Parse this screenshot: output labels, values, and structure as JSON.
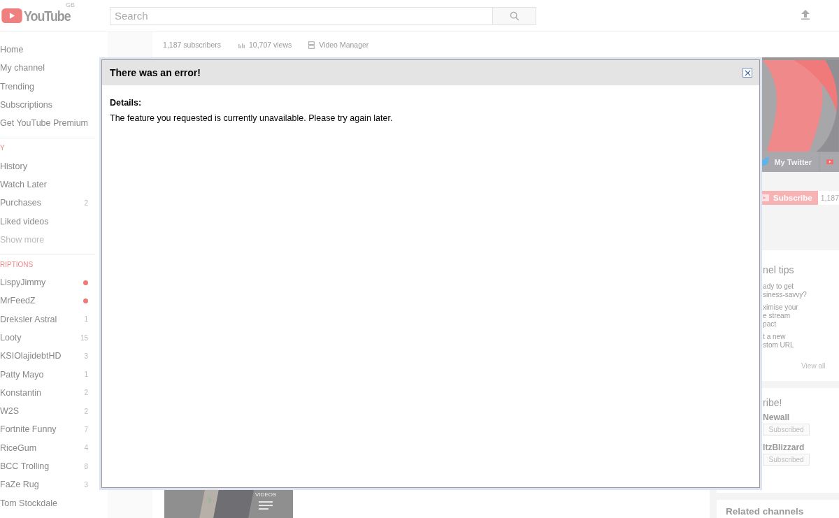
{
  "header": {
    "logo": "YouTube",
    "region": "GB",
    "search": {
      "placeholder": "Search"
    }
  },
  "stats": [
    {
      "kind": "text",
      "label": "1,187 subscribers"
    },
    {
      "kind": "views",
      "label": "10,707 views"
    },
    {
      "kind": "manager",
      "label": "Video Manager"
    }
  ],
  "sidebar": {
    "sections": [
      {
        "items": [
          {
            "label": "Home"
          },
          {
            "label": "My channel"
          },
          {
            "label": "Trending"
          },
          {
            "label": "Subscriptions"
          },
          {
            "label": "Get YouTube Premium"
          }
        ]
      },
      {
        "heading": "Y",
        "items": [
          {
            "label": "History"
          },
          {
            "label": "Watch Later"
          },
          {
            "label": "Purchases",
            "count": "2"
          },
          {
            "label": "Liked videos"
          },
          {
            "label": "Show more",
            "kind": "more"
          }
        ]
      },
      {
        "heading": "RIPTIONS",
        "items": [
          {
            "label": "LispyJimmy",
            "color": "#f07a7a"
          },
          {
            "label": "MrFeedZ",
            "color": "#f07a7a"
          },
          {
            "label": "Dreksler Astral",
            "count": "1"
          },
          {
            "label": "Looty",
            "count": "15"
          },
          {
            "label": "KSIOlajidebtHD",
            "count": "3"
          },
          {
            "label": "Patty Mayo",
            "count": "1"
          },
          {
            "label": "Konstantin",
            "count": "2"
          },
          {
            "label": "W2S",
            "count": "2"
          },
          {
            "label": "Fortnite Funny",
            "count": "7"
          },
          {
            "label": "RiceGum",
            "count": "4"
          },
          {
            "label": "BCC Trolling",
            "count": "8"
          },
          {
            "label": "FaZe Rug",
            "count": "3"
          },
          {
            "label": "Tom Stockdale"
          }
        ]
      }
    ]
  },
  "banner": {
    "link": "My Twitter",
    "subscribe": "Subscribe",
    "subscriber_count": "1,187"
  },
  "tips": {
    "title": "nel tips",
    "items": [
      [
        "ady to get",
        "siness-savvy?"
      ],
      [
        "ximise your",
        "e stream",
        "pact"
      ],
      [
        "t a new",
        "stom URL"
      ]
    ],
    "view_all": "View all"
  },
  "featured": {
    "title": "ribe!",
    "channels": [
      {
        "name": "Newall",
        "button": "Subscribed"
      },
      {
        "name": "ltzBlizzard",
        "button": "Subscribed"
      }
    ]
  },
  "related": {
    "title": "Related channels"
  },
  "video": {
    "label": "VIDEOS"
  },
  "dialog": {
    "title": "There was an error!",
    "details_label": "Details:",
    "message": "The feature you requested is currently unavailable. Please try again later."
  }
}
